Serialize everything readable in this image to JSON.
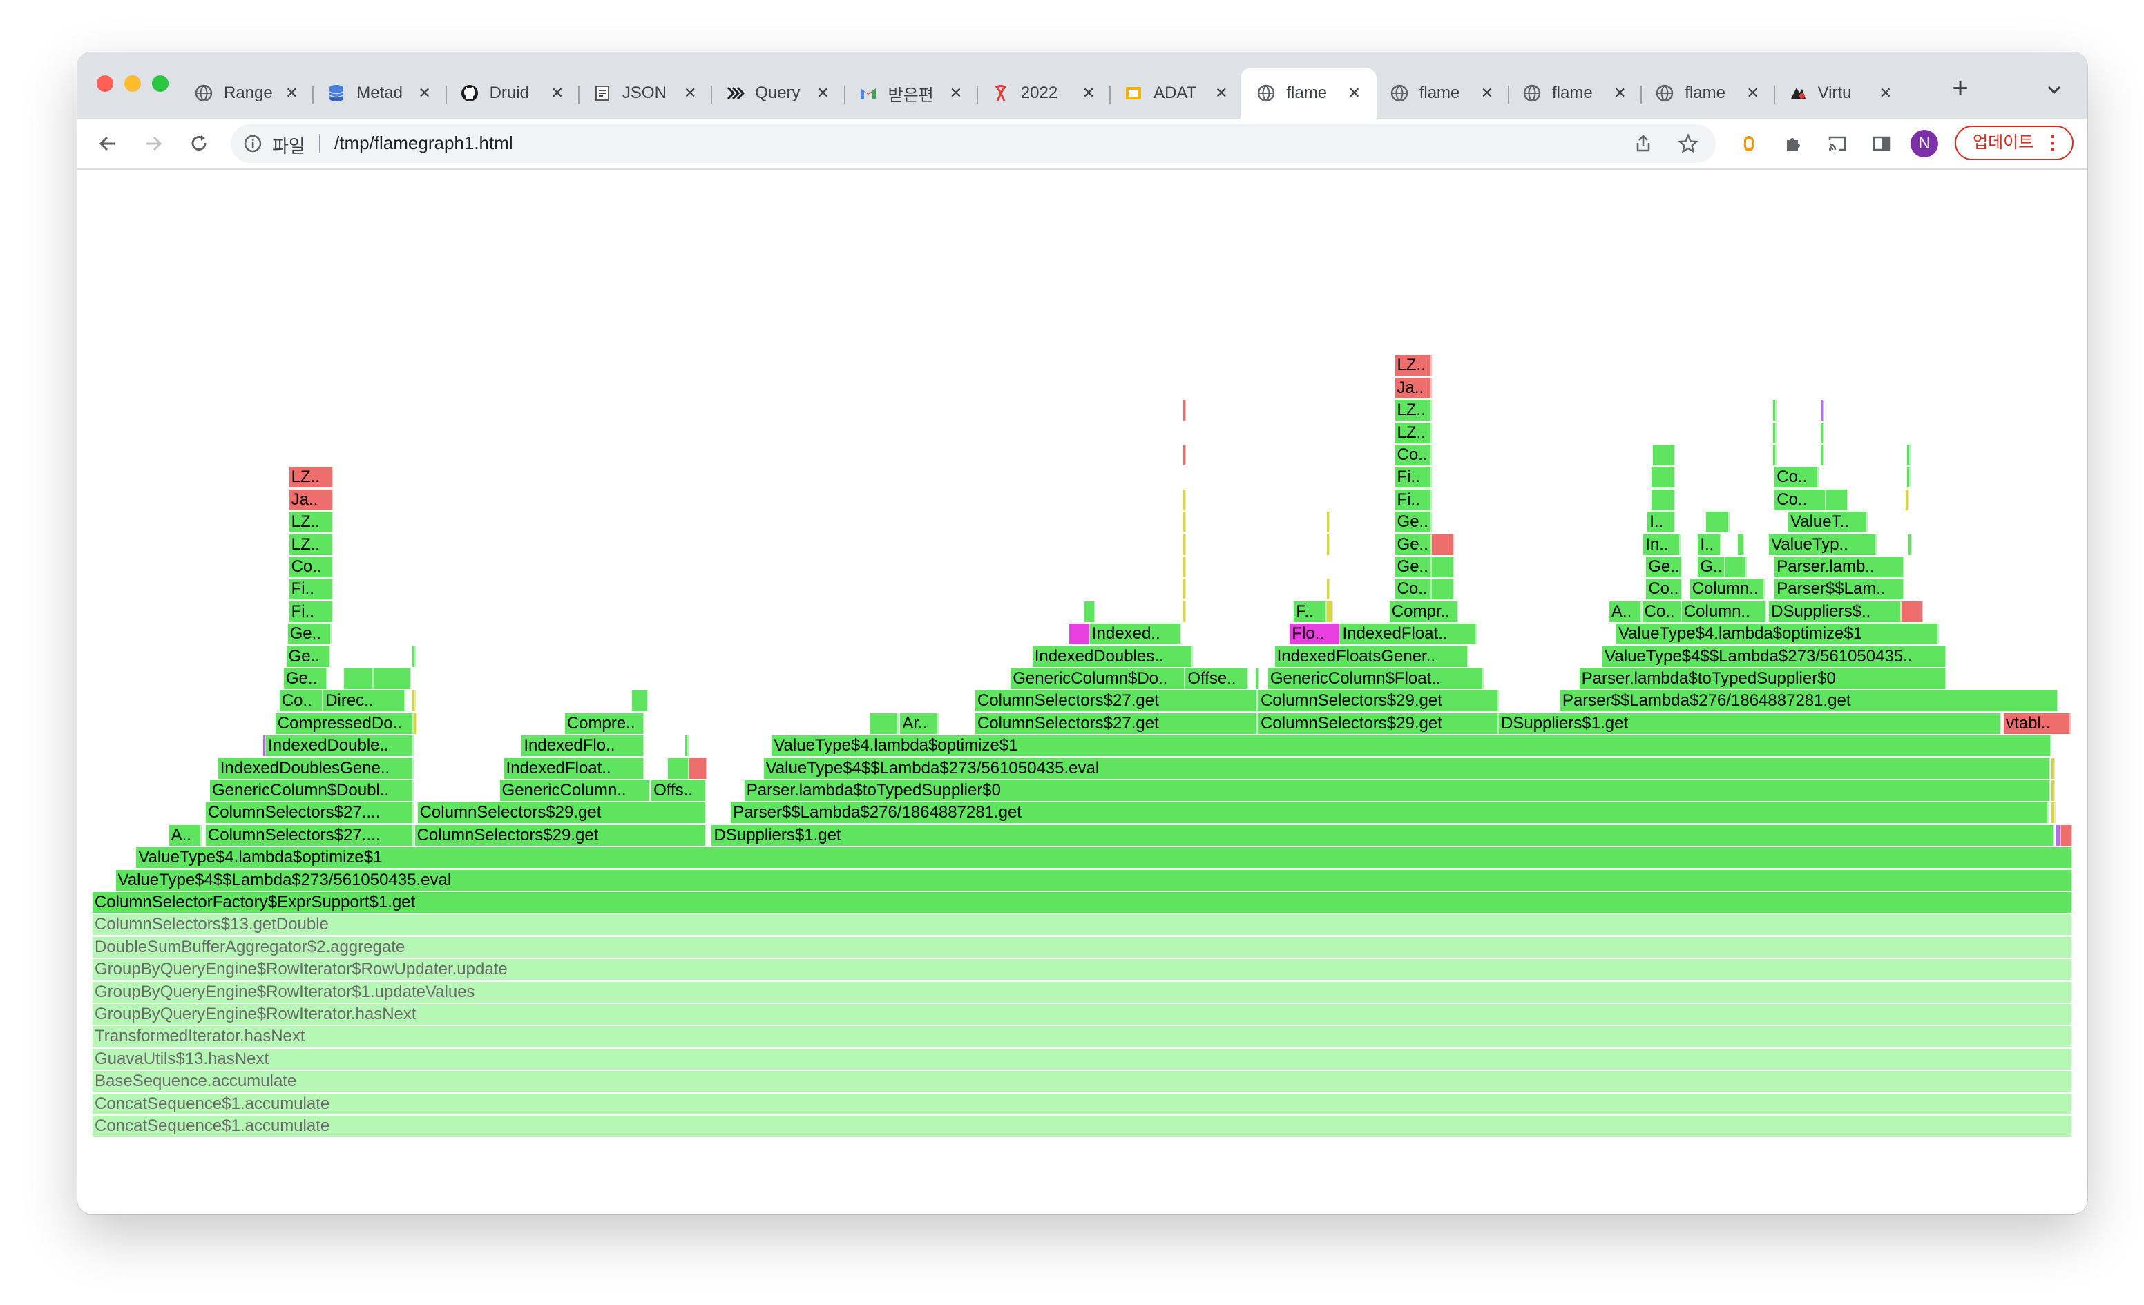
{
  "window": {
    "traffic_lights": [
      {
        "name": "close-light",
        "color": "#ff5f57"
      },
      {
        "name": "minimize-light",
        "color": "#febc2e"
      },
      {
        "name": "maximize-light",
        "color": "#28c840"
      }
    ]
  },
  "tabs": [
    {
      "title": "Range",
      "icon": "globe-icon",
      "active": false
    },
    {
      "title": "Metad",
      "icon": "database-icon",
      "active": false
    },
    {
      "title": "Druid",
      "icon": "github-icon",
      "active": false
    },
    {
      "title": "JSON",
      "icon": "json-icon",
      "active": false
    },
    {
      "title": "Query",
      "icon": "chevrons-icon",
      "active": false
    },
    {
      "title": "받은편",
      "icon": "gmail-icon",
      "active": false
    },
    {
      "title": "2022",
      "icon": "ribbon-icon",
      "active": false
    },
    {
      "title": "ADAT",
      "icon": "slides-icon",
      "active": false
    },
    {
      "title": "flame",
      "icon": "globe-icon",
      "active": true
    },
    {
      "title": "flame",
      "icon": "globe-icon",
      "active": false
    },
    {
      "title": "flame",
      "icon": "globe-icon",
      "active": false
    },
    {
      "title": "flame",
      "icon": "globe-icon",
      "active": false
    },
    {
      "title": "Virtu",
      "icon": "virtual-icon",
      "active": false
    }
  ],
  "toolbar": {
    "site_label": "파일",
    "url": "/tmp/flamegraph1.html",
    "update_label": "업데이트",
    "profile_initial": "N",
    "new_tab_symbol": "+"
  },
  "colors": {
    "frame_green": "#5fe45f",
    "frame_red": "#ee6e6e",
    "frame_magenta": "#e840e0",
    "frame_yellow": "#d6d640",
    "frame_purple": "#b070e0",
    "frame_faded": "#b6f7b6",
    "tab_bar": "#dee1e6",
    "update_red": "#d93025",
    "profile_purple": "#7b2fa8"
  },
  "flamegraph": {
    "frames": [
      {
        "l": "ColumnSelectorFactory$ExprSupport$1.get",
        "x": 0.0,
        "w": 1.0,
        "d": 0,
        "c": "g"
      },
      {
        "l": "ValueType$4$$Lambda$273/561050435.eval",
        "x": 0.0117,
        "w": 0.9883,
        "d": 1,
        "c": "g"
      },
      {
        "l": "ValueType$4.lambda$optimize$1",
        "x": 0.0221,
        "w": 0.9779,
        "d": 2,
        "c": "g"
      },
      {
        "l": "A..",
        "x": 0.0386,
        "w": 0.0166,
        "d": 3,
        "c": "g"
      },
      {
        "l": "ColumnSelectors$27....",
        "x": 0.0572,
        "w": 0.1049,
        "d": 3,
        "c": "g"
      },
      {
        "l": "ColumnSelectors$29.get",
        "x": 0.1628,
        "w": 0.1469,
        "d": 3,
        "c": "g"
      },
      {
        "l": "DSuppliers$1.get",
        "x": 0.3128,
        "w": 0.6783,
        "d": 3,
        "c": "g"
      },
      {
        "l": "",
        "x": 0.9918,
        "w": 0.0025,
        "d": 3,
        "c": "p"
      },
      {
        "l": "",
        "x": 0.9944,
        "w": 0.0056,
        "d": 3,
        "c": "r"
      },
      {
        "l": "ColumnSelectors$27....",
        "x": 0.0572,
        "w": 0.1049,
        "d": 4,
        "c": "g"
      },
      {
        "l": "ColumnSelectors$29.get",
        "x": 0.1642,
        "w": 0.1455,
        "d": 4,
        "c": "g"
      },
      {
        "l": "Parser$$Lambda$276/1864887281.get",
        "x": 0.3225,
        "w": 0.6658,
        "d": 4,
        "c": "g"
      },
      {
        "l": "",
        "x": 0.9897,
        "w": 0.0021,
        "d": 4,
        "c": "y"
      },
      {
        "l": "GenericColumn$Doubl..",
        "x": 0.0593,
        "w": 0.1028,
        "d": 5,
        "c": "g"
      },
      {
        "l": "GenericColumn..",
        "x": 0.2057,
        "w": 0.0759,
        "d": 5,
        "c": "g"
      },
      {
        "l": "Offs..",
        "x": 0.2823,
        "w": 0.0276,
        "d": 5,
        "c": "g"
      },
      {
        "l": "Parser.lambda$toTypedSupplier$0",
        "x": 0.3293,
        "w": 0.6597,
        "d": 5,
        "c": "g"
      },
      {
        "l": "",
        "x": 0.9897,
        "w": 0.0014,
        "d": 5,
        "c": "y"
      },
      {
        "l": "IndexedDoublesGene..",
        "x": 0.0634,
        "w": 0.0987,
        "d": 6,
        "c": "g"
      },
      {
        "l": "IndexedFloat..",
        "x": 0.2078,
        "w": 0.071,
        "d": 6,
        "c": "g"
      },
      {
        "l": "",
        "x": 0.2905,
        "w": 0.011,
        "d": 6,
        "c": "g"
      },
      {
        "l": "",
        "x": 0.3016,
        "w": 0.009,
        "d": 6,
        "c": "r"
      },
      {
        "l": "ValueType$4$$Lambda$273/561050435.eval",
        "x": 0.339,
        "w": 0.65,
        "d": 6,
        "c": "g"
      },
      {
        "l": "",
        "x": 0.9897,
        "w": 0.0014,
        "d": 6,
        "c": "y"
      },
      {
        "l": "",
        "x": 0.0862,
        "w": 0.0014,
        "d": 7,
        "c": "p"
      },
      {
        "l": "IndexedDouble..",
        "x": 0.0876,
        "w": 0.0745,
        "d": 7,
        "c": "g"
      },
      {
        "l": "IndexedFlo..",
        "x": 0.2168,
        "w": 0.0621,
        "d": 7,
        "c": "g"
      },
      {
        "l": "",
        "x": 0.2995,
        "w": 0.0014,
        "d": 7,
        "c": "g"
      },
      {
        "l": "ValueType$4.lambda$optimize$1",
        "x": 0.3431,
        "w": 0.6466,
        "d": 7,
        "c": "g"
      },
      {
        "l": "CompressedDo..",
        "x": 0.0924,
        "w": 0.0697,
        "d": 8,
        "c": "g"
      },
      {
        "l": "",
        "x": 0.1621,
        "w": 0.0014,
        "d": 8,
        "c": "y"
      },
      {
        "l": "Compre..",
        "x": 0.2386,
        "w": 0.0403,
        "d": 8,
        "c": "g"
      },
      {
        "l": "",
        "x": 0.3928,
        "w": 0.0145,
        "d": 8,
        "c": "g"
      },
      {
        "l": "Ar..",
        "x": 0.408,
        "w": 0.0193,
        "d": 8,
        "c": "g"
      },
      {
        "l": "ColumnSelectors$27.get",
        "x": 0.4459,
        "w": 0.1428,
        "d": 8,
        "c": "g"
      },
      {
        "l": "ColumnSelectors$29.get",
        "x": 0.589,
        "w": 0.1214,
        "d": 8,
        "c": "g"
      },
      {
        "l": "DSuppliers$1.get",
        "x": 0.7104,
        "w": 0.2538,
        "d": 8,
        "c": "g"
      },
      {
        "l": "vtabl..",
        "x": 0.9655,
        "w": 0.0338,
        "d": 8,
        "c": "r"
      },
      {
        "l": "Co..",
        "x": 0.0945,
        "w": 0.0221,
        "d": 9,
        "c": "g"
      },
      {
        "l": "Direc..",
        "x": 0.1166,
        "w": 0.0414,
        "d": 9,
        "c": "g"
      },
      {
        "l": "",
        "x": 0.1614,
        "w": 0.0014,
        "d": 9,
        "c": "y"
      },
      {
        "l": "",
        "x": 0.2724,
        "w": 0.0083,
        "d": 9,
        "c": "g"
      },
      {
        "l": "ColumnSelectors$27.get",
        "x": 0.4459,
        "w": 0.1428,
        "d": 9,
        "c": "g"
      },
      {
        "l": "ColumnSelectors$29.get",
        "x": 0.589,
        "w": 0.1214,
        "d": 9,
        "c": "g"
      },
      {
        "l": "Parser$$Lambda$276/1864887281.get",
        "x": 0.7414,
        "w": 0.2517,
        "d": 9,
        "c": "g"
      },
      {
        "l": "Ge..",
        "x": 0.0966,
        "w": 0.0221,
        "d": 10,
        "c": "g"
      },
      {
        "l": "",
        "x": 0.1269,
        "w": 0.0152,
        "d": 10,
        "c": "g"
      },
      {
        "l": "",
        "x": 0.1421,
        "w": 0.0186,
        "d": 10,
        "c": "g"
      },
      {
        "l": "GenericColumn$Do..",
        "x": 0.4638,
        "w": 0.0883,
        "d": 10,
        "c": "g"
      },
      {
        "l": "Offse..",
        "x": 0.5521,
        "w": 0.0317,
        "d": 10,
        "c": "g"
      },
      {
        "l": "",
        "x": 0.5876,
        "w": 0.0014,
        "d": 10,
        "c": "g"
      },
      {
        "l": "GenericColumn$Float..",
        "x": 0.5938,
        "w": 0.109,
        "d": 10,
        "c": "g"
      },
      {
        "l": "Parser.lambda$toTypedSupplier$0",
        "x": 0.7511,
        "w": 0.1855,
        "d": 10,
        "c": "g"
      },
      {
        "l": "Ge..",
        "x": 0.0979,
        "w": 0.0221,
        "d": 11,
        "c": "g"
      },
      {
        "l": "",
        "x": 0.1614,
        "w": 0.0014,
        "d": 11,
        "c": "g"
      },
      {
        "l": "IndexedDoubles..",
        "x": 0.4748,
        "w": 0.081,
        "d": 11,
        "c": "g"
      },
      {
        "l": "IndexedFloatsGener..",
        "x": 0.5972,
        "w": 0.0979,
        "d": 11,
        "c": "g"
      },
      {
        "l": "ValueType$4$$Lambda$273/561050435..",
        "x": 0.7628,
        "w": 0.1738,
        "d": 11,
        "c": "g"
      },
      {
        "l": "Ge..",
        "x": 0.0986,
        "w": 0.0221,
        "d": 12,
        "c": "g"
      },
      {
        "l": "",
        "x": 0.4934,
        "w": 0.0103,
        "d": 12,
        "c": "m"
      },
      {
        "l": "Indexed..",
        "x": 0.5038,
        "w": 0.0462,
        "d": 12,
        "c": "g"
      },
      {
        "l": "Flo..",
        "x": 0.6048,
        "w": 0.0255,
        "d": 12,
        "c": "m"
      },
      {
        "l": "IndexedFloat..",
        "x": 0.6303,
        "w": 0.069,
        "d": 12,
        "c": "g"
      },
      {
        "l": "ValueType$4.lambda$optimize$1",
        "x": 0.7697,
        "w": 0.1628,
        "d": 12,
        "c": "g"
      },
      {
        "l": "Fi..",
        "x": 0.0993,
        "w": 0.0221,
        "d": 13,
        "c": "g"
      },
      {
        "l": "",
        "x": 0.501,
        "w": 0.0055,
        "d": 13,
        "c": "g"
      },
      {
        "l": "",
        "x": 0.5507,
        "w": 0.0014,
        "d": 13,
        "c": "y"
      },
      {
        "l": "F..",
        "x": 0.6069,
        "w": 0.0166,
        "d": 13,
        "c": "g"
      },
      {
        "l": "",
        "x": 0.6234,
        "w": 0.0034,
        "d": 13,
        "c": "y"
      },
      {
        "l": "Compr..",
        "x": 0.6552,
        "w": 0.0345,
        "d": 13,
        "c": "g"
      },
      {
        "l": "A..",
        "x": 0.7662,
        "w": 0.0166,
        "d": 13,
        "c": "g"
      },
      {
        "l": "Co..",
        "x": 0.7828,
        "w": 0.02,
        "d": 13,
        "c": "g"
      },
      {
        "l": "Column..",
        "x": 0.8028,
        "w": 0.0428,
        "d": 13,
        "c": "g"
      },
      {
        "l": "DSuppliers$..",
        "x": 0.8469,
        "w": 0.0669,
        "d": 13,
        "c": "g"
      },
      {
        "l": "",
        "x": 0.9138,
        "w": 0.011,
        "d": 13,
        "c": "r"
      },
      {
        "l": "Fi..",
        "x": 0.0993,
        "w": 0.0221,
        "d": 14,
        "c": "g"
      },
      {
        "l": "Co..",
        "x": 0.6579,
        "w": 0.0186,
        "d": 14,
        "c": "g"
      },
      {
        "l": "",
        "x": 0.6766,
        "w": 0.011,
        "d": 14,
        "c": "g"
      },
      {
        "l": "",
        "x": 0.5507,
        "w": 0.0014,
        "d": 14,
        "c": "y"
      },
      {
        "l": "",
        "x": 0.6234,
        "w": 0.0014,
        "d": 14,
        "c": "y"
      },
      {
        "l": "Co..",
        "x": 0.7848,
        "w": 0.0179,
        "d": 14,
        "c": "g"
      },
      {
        "l": "Column..",
        "x": 0.8069,
        "w": 0.0379,
        "d": 14,
        "c": "g"
      },
      {
        "l": "Parser$$Lam..",
        "x": 0.8497,
        "w": 0.0655,
        "d": 14,
        "c": "g"
      },
      {
        "l": "Co..",
        "x": 0.0993,
        "w": 0.0221,
        "d": 15,
        "c": "g"
      },
      {
        "l": "Ge..",
        "x": 0.6579,
        "w": 0.0186,
        "d": 15,
        "c": "g"
      },
      {
        "l": "",
        "x": 0.6766,
        "w": 0.011,
        "d": 15,
        "c": "g"
      },
      {
        "l": "",
        "x": 0.5507,
        "w": 0.0014,
        "d": 15,
        "c": "y"
      },
      {
        "l": "Ge..",
        "x": 0.7848,
        "w": 0.0179,
        "d": 15,
        "c": "g"
      },
      {
        "l": "G..",
        "x": 0.811,
        "w": 0.0138,
        "d": 15,
        "c": "g"
      },
      {
        "l": "",
        "x": 0.8248,
        "w": 0.011,
        "d": 15,
        "c": "g"
      },
      {
        "l": "Parser.lamb..",
        "x": 0.8497,
        "w": 0.0655,
        "d": 15,
        "c": "g"
      },
      {
        "l": "LZ..",
        "x": 0.0993,
        "w": 0.0221,
        "d": 16,
        "c": "g"
      },
      {
        "l": "Ge..",
        "x": 0.6579,
        "w": 0.0186,
        "d": 16,
        "c": "g"
      },
      {
        "l": "",
        "x": 0.6766,
        "w": 0.011,
        "d": 16,
        "c": "r"
      },
      {
        "l": "",
        "x": 0.5507,
        "w": 0.0014,
        "d": 16,
        "c": "y"
      },
      {
        "l": "",
        "x": 0.6234,
        "w": 0.0014,
        "d": 16,
        "c": "y"
      },
      {
        "l": "In..",
        "x": 0.7834,
        "w": 0.0186,
        "d": 16,
        "c": "g"
      },
      {
        "l": "I..",
        "x": 0.811,
        "w": 0.0117,
        "d": 16,
        "c": "g"
      },
      {
        "l": "",
        "x": 0.831,
        "w": 0.0034,
        "d": 16,
        "c": "g"
      },
      {
        "l": "ValueTyp..",
        "x": 0.8469,
        "w": 0.0545,
        "d": 16,
        "c": "g"
      },
      {
        "l": "",
        "x": 0.9172,
        "w": 0.0014,
        "d": 16,
        "c": "g"
      },
      {
        "l": "LZ..",
        "x": 0.0993,
        "w": 0.0221,
        "d": 17,
        "c": "g"
      },
      {
        "l": "Ge..",
        "x": 0.6579,
        "w": 0.0186,
        "d": 17,
        "c": "g"
      },
      {
        "l": "",
        "x": 0.5507,
        "w": 0.0014,
        "d": 17,
        "c": "y"
      },
      {
        "l": "",
        "x": 0.6234,
        "w": 0.0014,
        "d": 17,
        "c": "y"
      },
      {
        "l": "I..",
        "x": 0.7855,
        "w": 0.0138,
        "d": 17,
        "c": "g"
      },
      {
        "l": "",
        "x": 0.8152,
        "w": 0.0117,
        "d": 17,
        "c": "g"
      },
      {
        "l": "ValueT..",
        "x": 0.8566,
        "w": 0.04,
        "d": 17,
        "c": "g"
      },
      {
        "l": "Ja..",
        "x": 0.0993,
        "w": 0.0221,
        "d": 18,
        "c": "r"
      },
      {
        "l": "Fi..",
        "x": 0.6579,
        "w": 0.0186,
        "d": 18,
        "c": "g"
      },
      {
        "l": "",
        "x": 0.5507,
        "w": 0.0014,
        "d": 18,
        "c": "y"
      },
      {
        "l": "",
        "x": 0.7876,
        "w": 0.0117,
        "d": 18,
        "c": "g"
      },
      {
        "l": "Co..",
        "x": 0.8497,
        "w": 0.0262,
        "d": 18,
        "c": "g"
      },
      {
        "l": "",
        "x": 0.8759,
        "w": 0.011,
        "d": 18,
        "c": "g"
      },
      {
        "l": "",
        "x": 0.9159,
        "w": 0.0014,
        "d": 18,
        "c": "y"
      },
      {
        "l": "LZ..",
        "x": 0.0993,
        "w": 0.0221,
        "d": 19,
        "c": "r"
      },
      {
        "l": "Fi..",
        "x": 0.6579,
        "w": 0.0186,
        "d": 19,
        "c": "g"
      },
      {
        "l": "",
        "x": 0.7876,
        "w": 0.0117,
        "d": 19,
        "c": "g"
      },
      {
        "l": "Co..",
        "x": 0.8497,
        "w": 0.0221,
        "d": 19,
        "c": "g"
      },
      {
        "l": "",
        "x": 0.9165,
        "w": 0.0014,
        "d": 19,
        "c": "g"
      },
      {
        "l": "Co..",
        "x": 0.6579,
        "w": 0.0186,
        "d": 20,
        "c": "g"
      },
      {
        "l": "",
        "x": 0.5507,
        "w": 0.0014,
        "d": 20,
        "c": "r"
      },
      {
        "l": "",
        "x": 0.7883,
        "w": 0.011,
        "d": 20,
        "c": "g"
      },
      {
        "l": "",
        "x": 0.849,
        "w": 0.0014,
        "d": 20,
        "c": "g"
      },
      {
        "l": "",
        "x": 0.8731,
        "w": 0.0014,
        "d": 20,
        "c": "g"
      },
      {
        "l": "",
        "x": 0.9165,
        "w": 0.0014,
        "d": 20,
        "c": "g"
      },
      {
        "l": "LZ..",
        "x": 0.6579,
        "w": 0.0186,
        "d": 21,
        "c": "g"
      },
      {
        "l": "",
        "x": 0.849,
        "w": 0.0014,
        "d": 21,
        "c": "g"
      },
      {
        "l": "",
        "x": 0.8731,
        "w": 0.0014,
        "d": 21,
        "c": "g"
      },
      {
        "l": "LZ..",
        "x": 0.6579,
        "w": 0.0186,
        "d": 22,
        "c": "g"
      },
      {
        "l": "",
        "x": 0.5507,
        "w": 0.0014,
        "d": 22,
        "c": "r"
      },
      {
        "l": "",
        "x": 0.849,
        "w": 0.0014,
        "d": 22,
        "c": "g"
      },
      {
        "l": "",
        "x": 0.8731,
        "w": 0.0014,
        "d": 22,
        "c": "p"
      },
      {
        "l": "Ja..",
        "x": 0.6579,
        "w": 0.0186,
        "d": 23,
        "c": "r"
      },
      {
        "l": "LZ..",
        "x": 0.6579,
        "w": 0.0186,
        "d": 24,
        "c": "r"
      }
    ],
    "faded_frames": [
      "ColumnSelectors$13.getDouble",
      "DoubleSumBufferAggregator$2.aggregate",
      "GroupByQueryEngine$RowIterator$RowUpdater.update",
      "GroupByQueryEngine$RowIterator$1.updateValues",
      "GroupByQueryEngine$RowIterator.hasNext",
      "TransformedIterator.hasNext",
      "GuavaUtils$13.hasNext",
      "BaseSequence.accumulate",
      "ConcatSequence$1.accumulate",
      "ConcatSequence$1.accumulate"
    ]
  }
}
